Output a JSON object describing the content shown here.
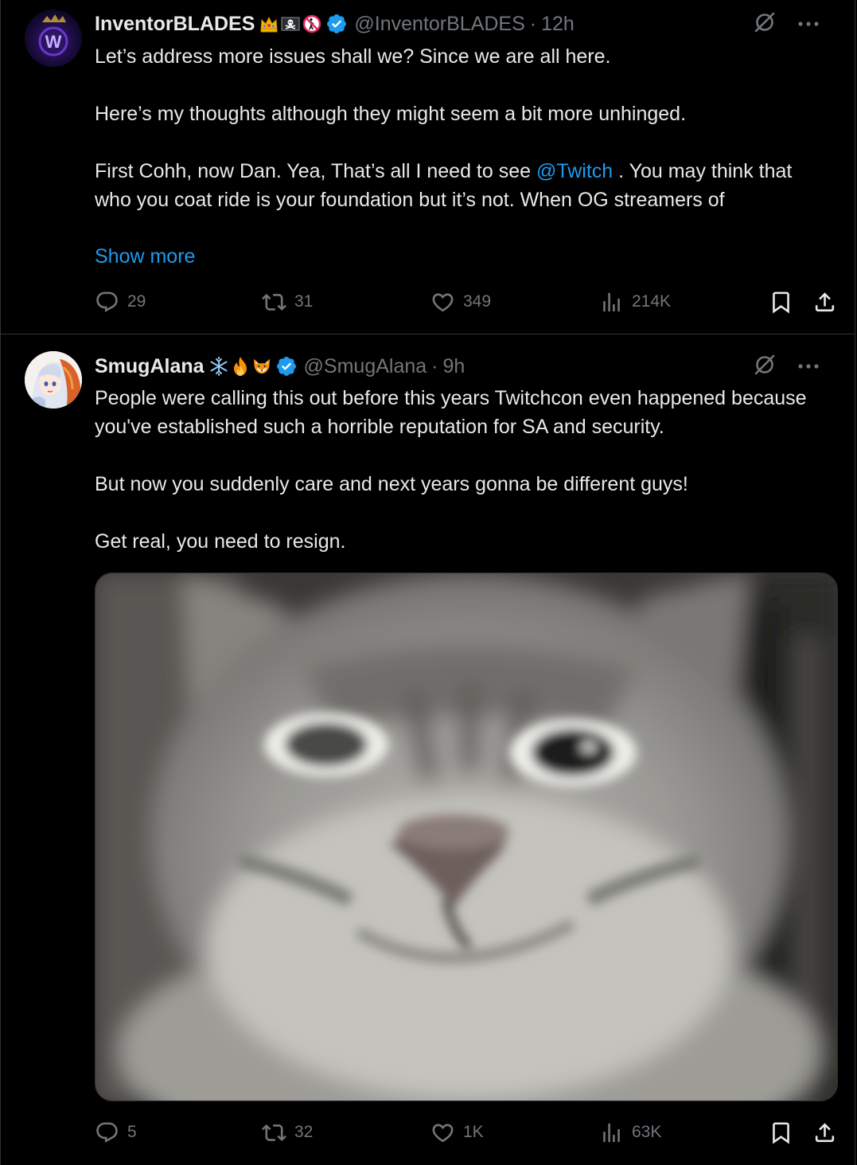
{
  "tweets": [
    {
      "display_name": "InventorBLADES",
      "badges": [
        "crown-emoji",
        "pirate-flag-emoji",
        "no-littering-emoji"
      ],
      "verified": true,
      "handle": "@InventorBLADES",
      "separator": "·",
      "time": "12h",
      "text_parts": {
        "p1": "Let’s address more issues shall we? Since we are all here.",
        "p2": "Here’s my thoughts although they might seem a bit more unhinged.",
        "p3_before": "First Cohh, now Dan. Yea, That’s all I need to see ",
        "p3_mention": "@Twitch",
        "p3_after": " . You may think that who you coat ride is your foundation but it’s not. When OG streamers of"
      },
      "show_more": "Show more",
      "stats": {
        "replies": "29",
        "reposts": "31",
        "likes": "349",
        "views": "214K"
      }
    },
    {
      "display_name": "SmugAlana",
      "badges": [
        "snowflake-emoji",
        "fire-emoji",
        "fox-emoji"
      ],
      "verified": true,
      "handle": "@SmugAlana",
      "separator": "·",
      "time": "9h",
      "text_parts": {
        "p1": "People were calling this out before this years Twitchcon even happened because you've established such a horrible reputation for SA and security.",
        "p2": "But now you suddenly care and next years gonna be different guys!",
        "p3": "Get real, you need to resign."
      },
      "media": "cat-photo",
      "stats": {
        "replies": "5",
        "reposts": "32",
        "likes": "1K",
        "views": "63K"
      }
    }
  ],
  "colors": {
    "background": "#000000",
    "text": "#e7e9ea",
    "muted": "#71767b",
    "link": "#1d9bf0",
    "verified": "#1d9bf0",
    "divider": "#2f3336"
  }
}
